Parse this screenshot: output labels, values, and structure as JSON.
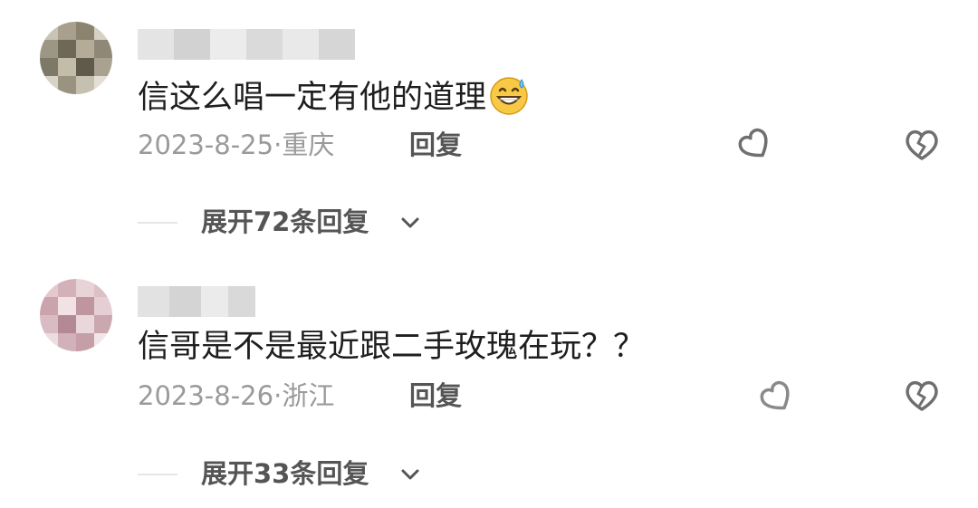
{
  "comments": [
    {
      "text": "信这么唱一定有他的道理",
      "emoji": "grinning-sweat-face",
      "date": "2023-8-25·",
      "location": "重庆",
      "reply_label": "回复",
      "like_count": "",
      "expand_label": "展开72条回复"
    },
    {
      "text": "信哥是不是最近跟二手玫瑰在玩？？",
      "date": "2023-8-26·",
      "location": "浙江",
      "reply_label": "回复",
      "like_count": "",
      "expand_label": "展开33条回复"
    }
  ],
  "icons": {
    "like": "heart-outline-icon",
    "dislike": "broken-heart-icon",
    "expand": "chevron-down-icon"
  },
  "colors": {
    "text": "#1f1f1f",
    "meta": "#9a9a9a",
    "action": "#555555",
    "icon": "#7a7a7a"
  }
}
